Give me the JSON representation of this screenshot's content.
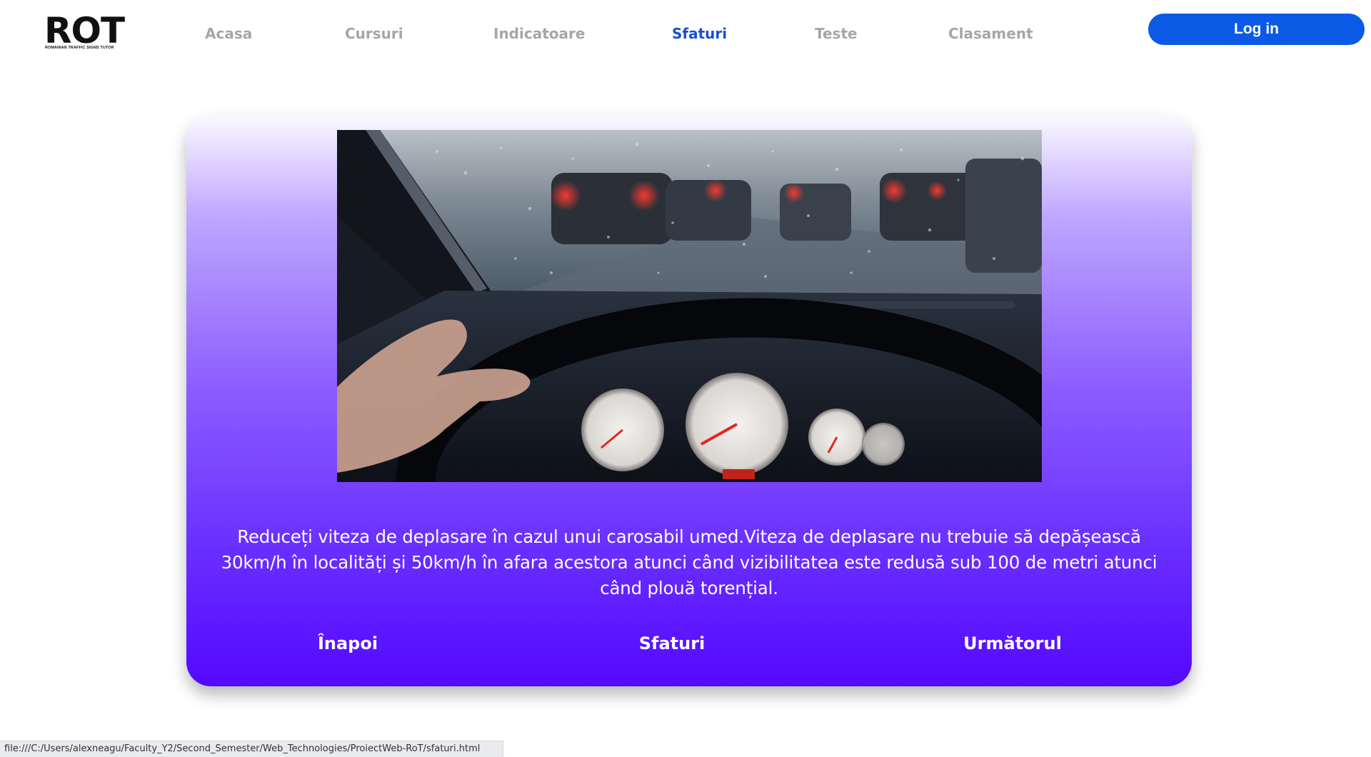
{
  "header": {
    "logo_text": "ROT",
    "logo_subtitle": "ROMANIAN TRAFFIC SIGNS TUTOR",
    "nav": [
      {
        "label": "Acasa",
        "active": false
      },
      {
        "label": "Cursuri",
        "active": false
      },
      {
        "label": "Indicatoare",
        "active": false
      },
      {
        "label": "Sfaturi",
        "active": true
      },
      {
        "label": "Teste",
        "active": false
      },
      {
        "label": "Clasament",
        "active": false
      }
    ],
    "login_label": "Log in"
  },
  "card": {
    "tip_text": "Reduceți viteza de deplasare în cazul unui carosabil umed.Viteza de deplasare nu trebuie să depășească 30km/h în localități și 50km/h în afara acestora atunci când vizibilitatea este redusă sub 100 de metri atunci când plouă torențial.",
    "prev_label": "Înapoi",
    "center_label": "Sfaturi",
    "next_label": "Următorul"
  },
  "status_bar": {
    "url": "file:///C:/Users/alexneagu/Faculty_Y2/Second_Semester/Web_Technologies/ProiectWeb-RoT/sfaturi.html"
  },
  "colors": {
    "accent": "#0a5ae6",
    "active_nav": "#1a4fd1",
    "inactive_nav": "#a6a6a6",
    "card_gradient_top": "#fbf9ff",
    "card_gradient_bottom": "#5408ff"
  }
}
